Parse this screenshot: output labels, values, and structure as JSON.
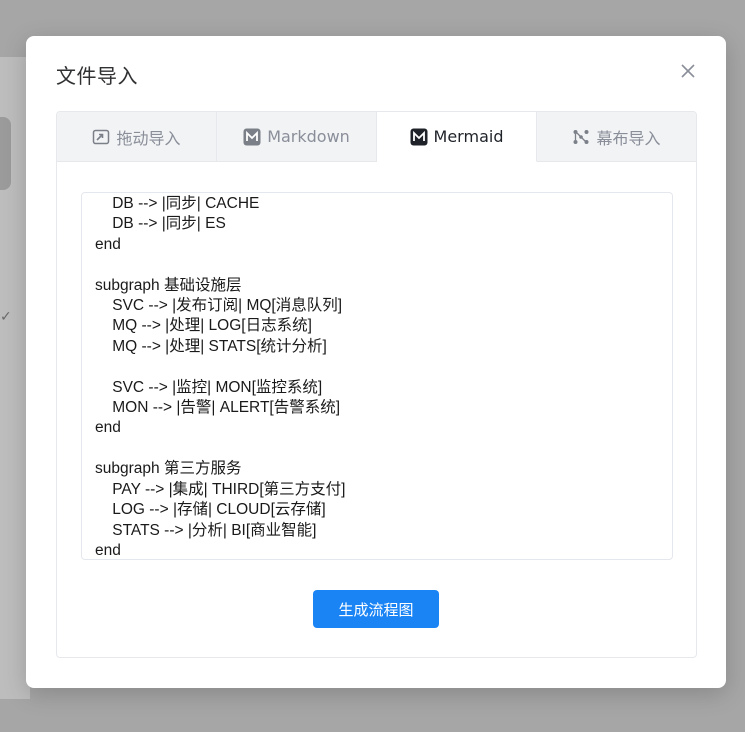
{
  "modal": {
    "title": "文件导入",
    "close_label": "×"
  },
  "tabs": [
    {
      "label": "拖动导入",
      "icon": "drag-import-icon",
      "active": false
    },
    {
      "label": "Markdown",
      "icon": "markdown-icon",
      "active": false
    },
    {
      "label": "Mermaid",
      "icon": "mermaid-icon",
      "active": true
    },
    {
      "label": "幕布导入",
      "icon": "mubu-icon",
      "active": false
    }
  ],
  "editor": {
    "content": "    DB --> |同步| CACHE\n    DB --> |同步| ES\nend\n\nsubgraph 基础设施层\n    SVC --> |发布订阅| MQ[消息队列]\n    MQ --> |处理| LOG[日志系统]\n    MQ --> |处理| STATS[统计分析]\n\n    SVC --> |监控| MON[监控系统]\n    MON --> |告警| ALERT[告警系统]\nend\n\nsubgraph 第三方服务\n    PAY --> |集成| THIRD[第三方支付]\n    LOG --> |存储| CLOUD[云存储]\n    STATS --> |分析| BI[商业智能]\nend"
  },
  "actions": {
    "generate_label": "生成流程图"
  },
  "colors": {
    "accent": "#1a84f5",
    "overlay": "#a6a6a6"
  }
}
